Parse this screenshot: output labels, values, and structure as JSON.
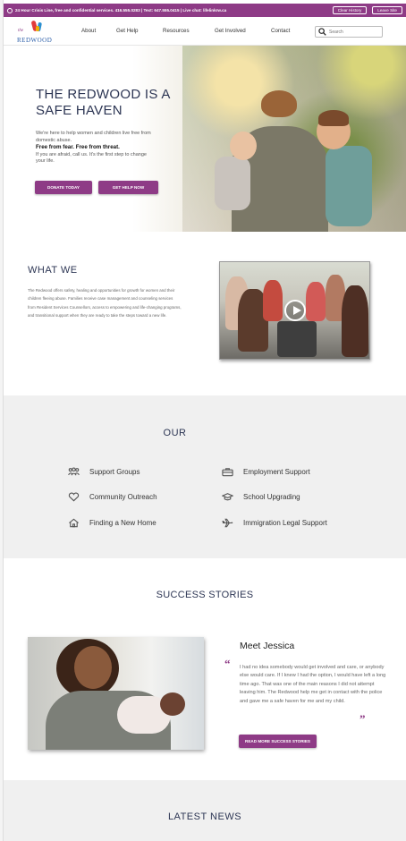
{
  "topbar": {
    "crisis_text": "24 Hour Crisis Line, free and confidential services. 416.555.0283 | Text: 647.555.0415 | Live chat: lifelinkrw.ca",
    "clear_history": "Clear History",
    "leave_site": "Leave Site",
    "color": "#8e3b86"
  },
  "nav": {
    "logo_the": "the",
    "logo_name": "REDWOOD",
    "items": [
      "About",
      "Get Help",
      "Resources",
      "Get Involved",
      "Contact"
    ],
    "search_placeholder": "Search"
  },
  "hero": {
    "title": "THE REDWOOD IS A SAFE HAVEN",
    "line1": "We're here to help women and children live free from domestic abuse.",
    "bold": "Free from fear. Free from threat.",
    "line2": "If you are afraid, call us. It's the first step to change your life.",
    "donate": "DONATE TODAY",
    "get_help": "GET HELP NOW"
  },
  "what_we": {
    "title": "WHAT WE",
    "body": "The Redwood offers safety, healing and opportunities for growth for women and their children fleeing abuse. Families receive case management and counseling services from Resident Services Counsellors, access to empowering and life-changing programs, and transitional support when they are ready to take the steps toward a new life."
  },
  "our": {
    "title": "OUR",
    "services": [
      {
        "label": "Support Groups",
        "icon": "group-icon"
      },
      {
        "label": "Employment Support",
        "icon": "briefcase-icon"
      },
      {
        "label": "Community Outreach",
        "icon": "heart-icon"
      },
      {
        "label": "School Upgrading",
        "icon": "graduation-cap-icon"
      },
      {
        "label": "Finding a New Home",
        "icon": "home-icon"
      },
      {
        "label": "Immigration Legal Support",
        "icon": "airplane-icon"
      }
    ]
  },
  "stories": {
    "title": "SUCCESS STORIES",
    "name": "Meet Jessica",
    "open_quote": "“",
    "close_quote": "”",
    "quote": "I had no idea somebody would get involved and care, or anybody else would care. If I knew I had the option, I would have left a long time ago. That was one of the main reasons I did not attempt leaving him. The Redwood help me get in contact with the police and gave me a safe haven for me and my child.",
    "button": "READ MORE SUCCESS STORIES"
  },
  "news": {
    "title": "LATEST NEWS"
  }
}
